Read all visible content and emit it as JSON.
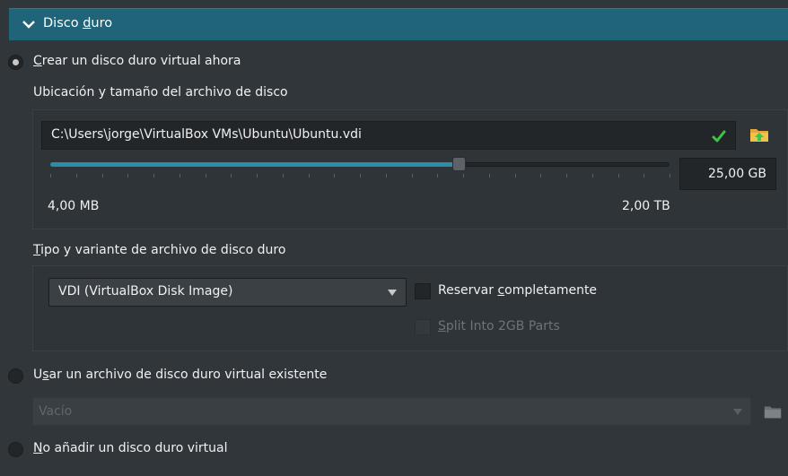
{
  "section": {
    "title_pre": "Disco ",
    "title_u": "d",
    "title_post": "uro"
  },
  "options": {
    "create": {
      "u": "C",
      "rest": "rear un disco duro virtual ahora",
      "selected": true
    },
    "existing": {
      "pre": "U",
      "u": "s",
      "rest": "ar un archivo de disco duro virtual existente",
      "selected": false
    },
    "none": {
      "u": "N",
      "rest": "o añadir un disco duro virtual",
      "selected": false
    }
  },
  "location": {
    "label": "Ubicación y tamaño del archivo de disco",
    "path": "C:\\Users\\jorge\\VirtualBox VMs\\Ubuntu\\Ubuntu.vdi",
    "size_value": "25,00 GB",
    "min_label": "4,00 MB",
    "max_label": "2,00 TB",
    "slider_fraction": 0.66
  },
  "type": {
    "label_u": "T",
    "label_rest": "ipo y variante de archivo de disco duro",
    "selected": "VDI (VirtualBox Disk Image)",
    "reserve_pre": "Reservar ",
    "reserve_u": "c",
    "reserve_post": "ompletamente",
    "reserve_checked": false,
    "split_u": "S",
    "split_rest": "plit Into 2GB Parts",
    "split_checked": false
  },
  "existing_disk": {
    "selected": "Vacío"
  },
  "colors": {
    "accent": "#2a8ea8",
    "header": "#1f6478",
    "check": "#3ec34a",
    "folder": "#e8a43a"
  }
}
